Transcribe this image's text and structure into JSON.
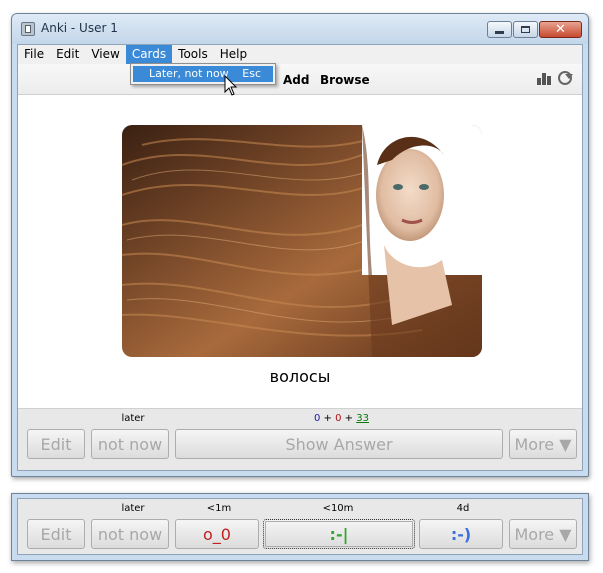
{
  "window": {
    "title": "Anki - User 1",
    "controls": {
      "minimize": "minimize",
      "maximize": "maximize",
      "close": "close"
    }
  },
  "menu": {
    "items": [
      "File",
      "Edit",
      "View",
      "Cards",
      "Tools",
      "Help"
    ],
    "active": "Cards"
  },
  "dropdown": {
    "label": "Later, not now",
    "shortcut": "Esc"
  },
  "toolbar": {
    "add": "Add",
    "browse": "Browse",
    "icons": [
      "stats-icon",
      "sync-icon"
    ]
  },
  "card": {
    "image_desc": "woman-long-hair-photo",
    "word": "волосы"
  },
  "review_bar": {
    "later_label": "later",
    "counts": {
      "new": "0",
      "sep1": " + ",
      "learning": "0",
      "sep2": " + ",
      "review": "33"
    },
    "edit": "Edit",
    "not_now": "not now",
    "show_answer": "Show Answer",
    "more": "More ▼"
  },
  "answer_bar": {
    "later_label": "later",
    "again_time": "<1m",
    "good_time": "<10m",
    "easy_time": "4d",
    "edit": "Edit",
    "not_now": "not now",
    "again": "o_0",
    "good": ":-|",
    "easy": ":-)",
    "more": "More ▼"
  },
  "colors": {
    "window_frame": "#c9dbee",
    "menu_highlight": "#3a8ad8",
    "again": "#c02020",
    "good": "#2fa82f",
    "easy": "#3a6fe0"
  }
}
